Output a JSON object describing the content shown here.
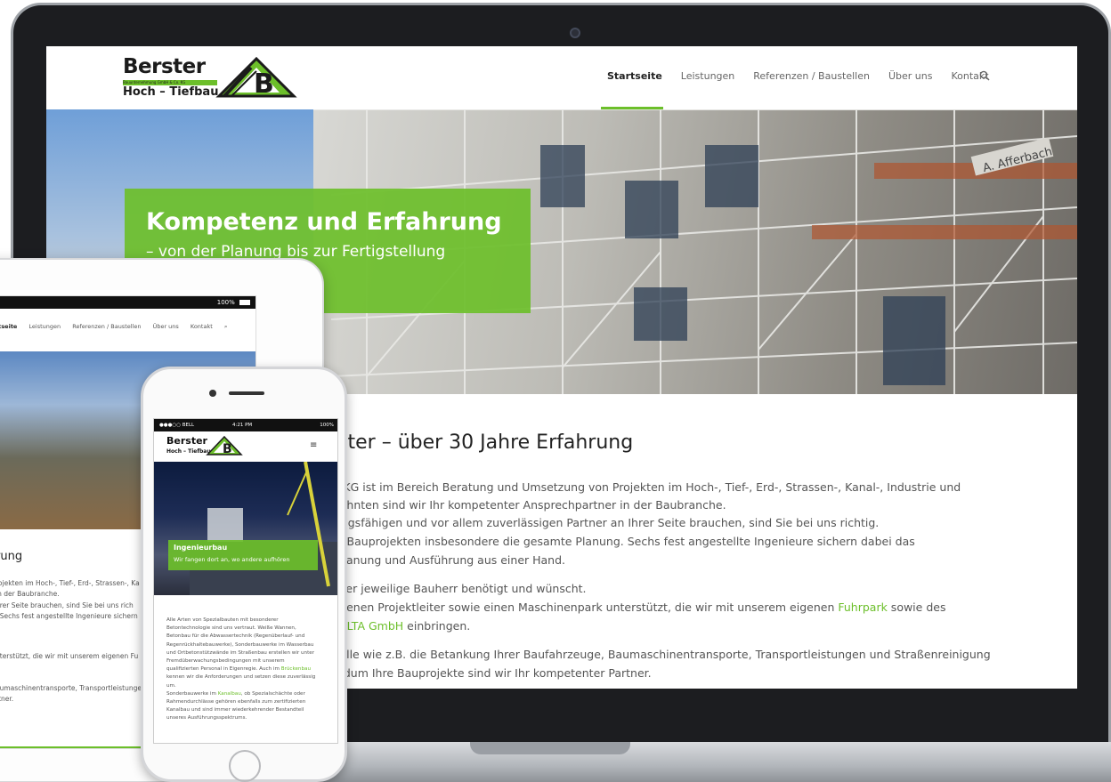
{
  "laptop": {
    "logo": {
      "word": "Berster",
      "bar_text": "Bauunternehmung GmbH & Co. KG",
      "sub": "Hoch – Tiefbau",
      "mark_letter": "B"
    },
    "nav": {
      "items": [
        "Startseite",
        "Leistungen",
        "Referenzen / Baustellen",
        "Über uns",
        "Kontakt"
      ],
      "active": "Startseite"
    },
    "hero": {
      "title": "Kompetenz und Erfahrung",
      "subtitle": "– von der Planung bis zur Fertigstellung",
      "sign_text": "A. Afferbach"
    },
    "content": {
      "heading": "rster – über 30 Jahre Erfahrung",
      "lines": [
        "o. KG ist im Bereich Beratung und Umsetzung von Projekten im Hoch-, Tief-, Erd-, Strassen-, Kanal-, Industrie und",
        "rzehnten sind wir Ihr kompetenter Ansprechpartner in der Baubranche.",
        "tungsfähigen und vor allem zuverlässigen Partner an Ihrer Seite brauchen, sind Sie bei uns richtig.",
        "on Bauprojekten insbesondere die gesamte Planung. Sechs fest angestellte Ingenieure sichern dabei das",
        ", Planung und Ausführung aus einer Hand.",
        "s der jeweilige Bauherr benötigt und wünscht."
      ],
      "line7_pre": "eigenen Projektleiter sowie einen Maschinenpark unterstützt, die wir mit unserem eigenen ",
      "line7_link": "Fuhrpark",
      "line7_post": " sowie des",
      "line8_pre": "na ",
      "line8_link": "LTA GmbH",
      "line8_post": " einbringen.",
      "line9": "stelle wie z.B. die Betankung Ihrer Baufahrzeuge, Baumaschinentransporte, Transportleistungen und Straßenreinigung",
      "line10": "undum Ihre Bauprojekte sind wir Ihr kompetenter Partner."
    }
  },
  "tablet": {
    "status": "100%",
    "nav": [
      "rtseite",
      "Leistungen",
      "Referenzen / Baustellen",
      "Über uns",
      "Kontakt"
    ],
    "heading": "rung",
    "lines": [
      "rojekten im Hoch-, Tief-, Erd-, Strassen-, Ka",
      "in der Baubranche.",
      "hrer Seite brauchen, sind Sie bei uns rich",
      ". Sechs fest angestellte Ingenieure sichern",
      "nterstützt, die wir mit unserem eigenen Fu",
      "aumaschinentransporte, Transportleistunge",
      "rtner."
    ],
    "last_link": "t."
  },
  "phone": {
    "status_left": "●●●○○ BELL",
    "status_time": "4:21 PM",
    "status_right": "100%",
    "logo_word": "Berster",
    "logo_sub": "Hoch – Tiefbau",
    "logo_mark": "B",
    "menu_icon": "≡",
    "banner_title": "Ingenieurbau",
    "banner_sub": "Wir fangen dort an, wo andere aufhören",
    "body_lines": [
      "Alle Arten von Spezialbauten mit besonderer",
      "Betontechnologie sind uns vertraut. Weiße Wannen,",
      "Betonbau für die Abwassertechnik (Regenüberlauf- und",
      "Regenrückhaltebauwerke), Sonderbauwerke im Wasserbau",
      "und Ortbetonstützwände im Straßenbau erstellen wir unter",
      "Fremdüberwachungsbedingungen mit unserem",
      "qualifizierten Personal in Eigenregie. Auch im"
    ],
    "link1": "Brückenbau",
    "body_after_link1": [
      "kennen wir die Anforderungen und setzen diese zuverlässig",
      "um."
    ],
    "line_sonder_pre": "Sonderbauwerke im ",
    "link2": "Kanalbau",
    "line_sonder_post": ", ob Spezialschächte oder",
    "body_end": [
      "Rahmendurchlässe gehören ebenfalls zum zertifizierten",
      "Kanalbau und sind immer wiederkehrender Bestandteil",
      "unseres Ausführungsspektrums."
    ]
  },
  "colors": {
    "brand_green": "#6cbf2a",
    "text_dark": "#222222",
    "laptop_bezel": "#1c1d20"
  },
  "icons": [
    "search-icon",
    "hamburger-menu-icon",
    "logo-mark-icon",
    "battery-icon"
  ]
}
